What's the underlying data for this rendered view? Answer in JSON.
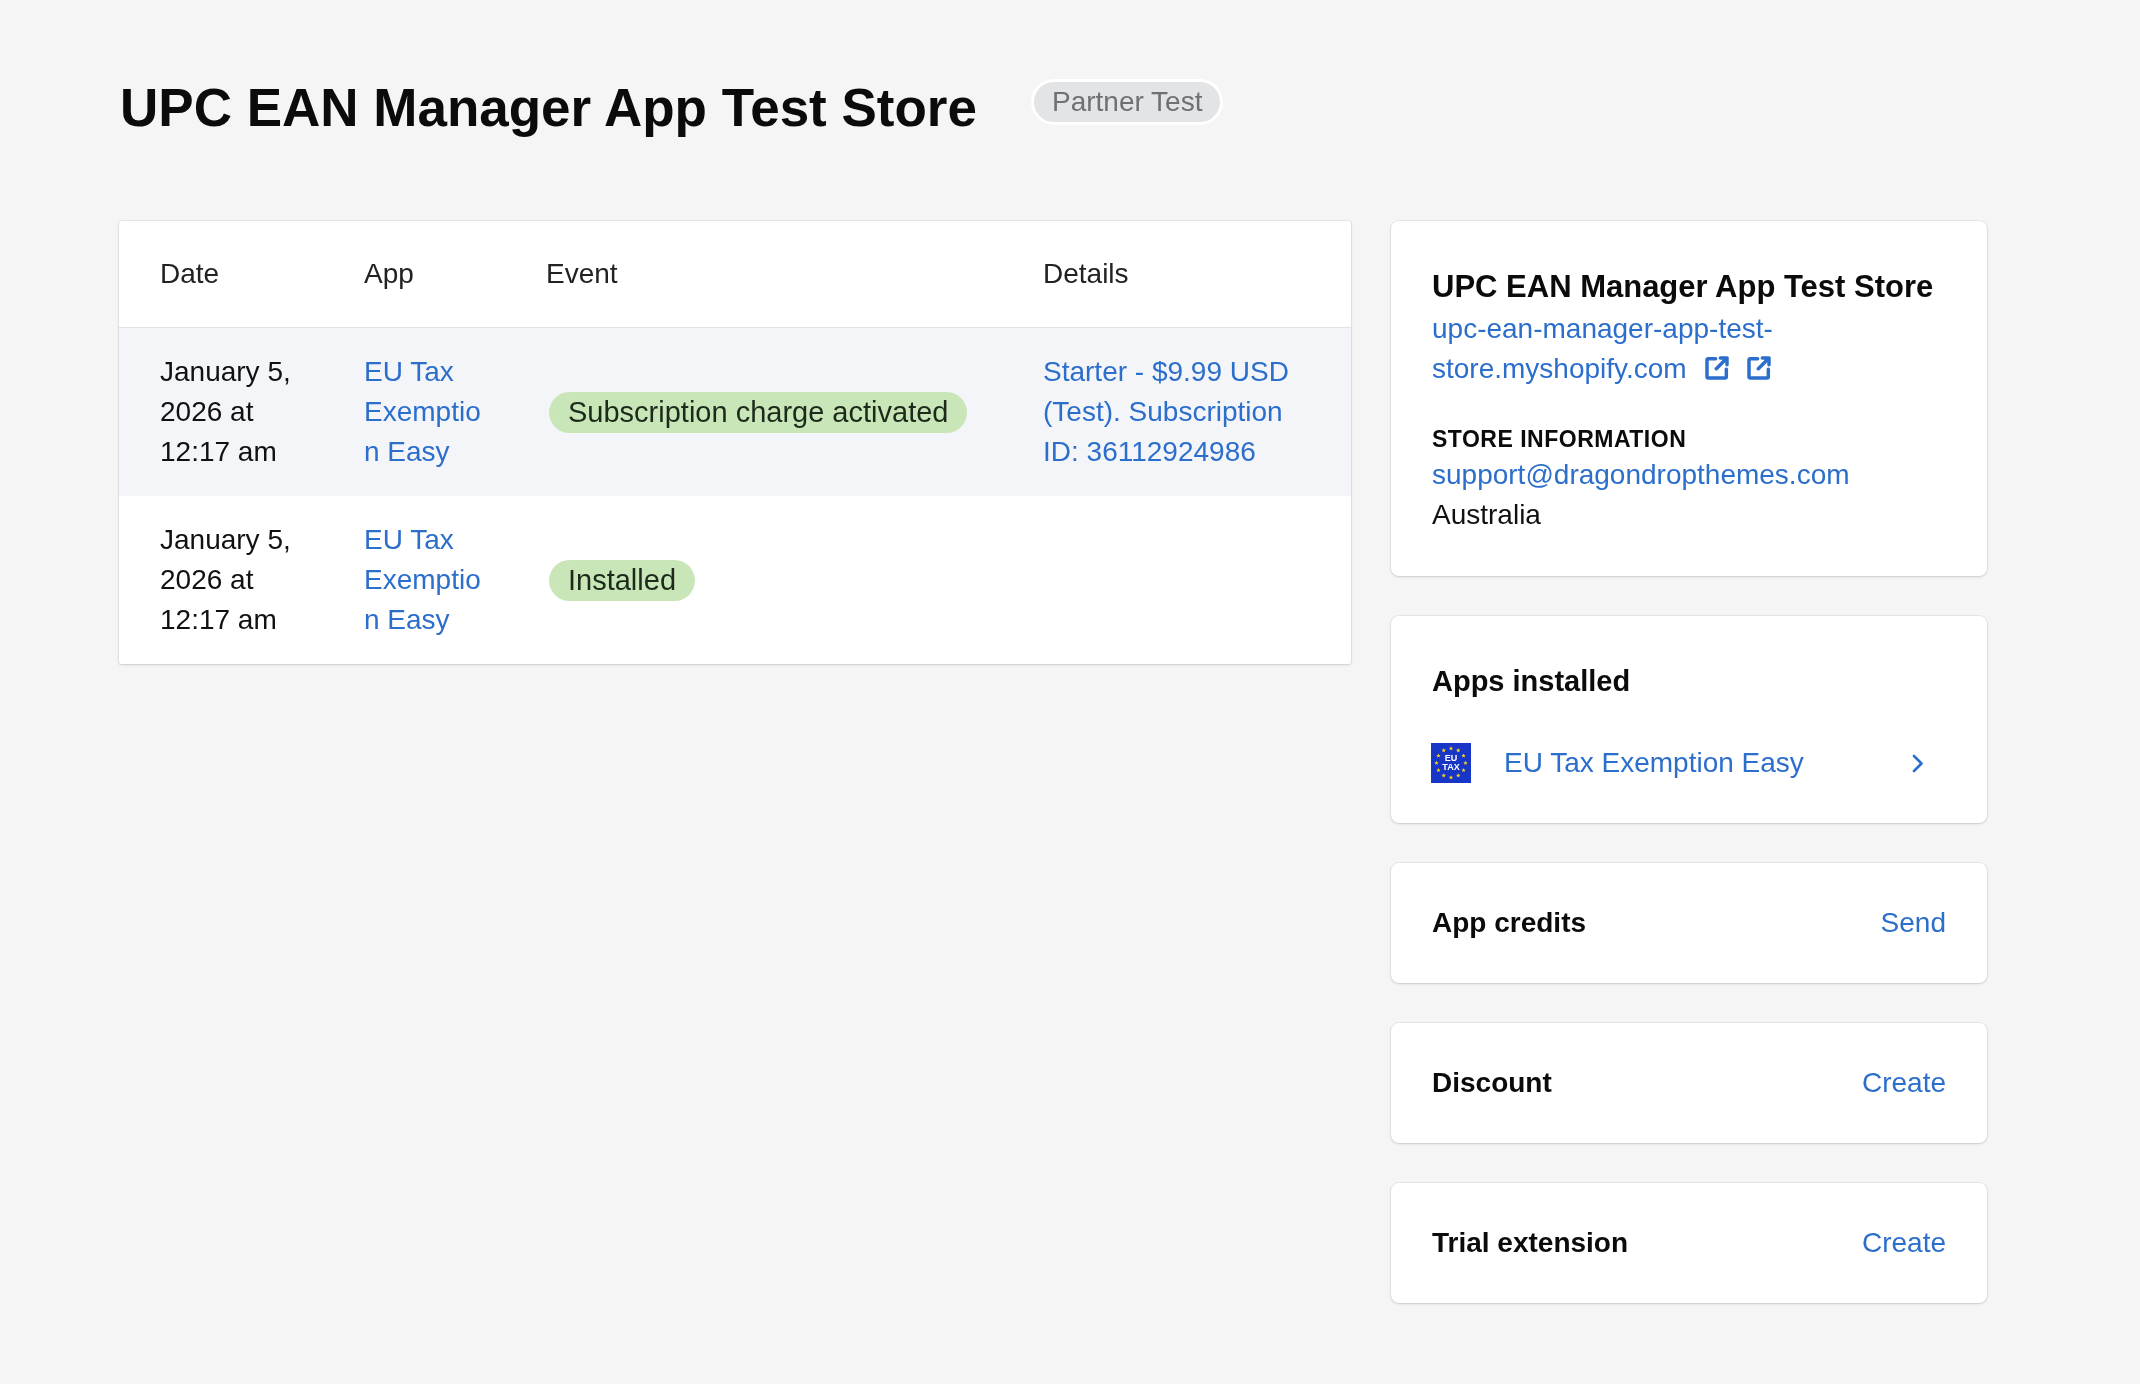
{
  "header": {
    "title": "UPC EAN Manager App Test Store",
    "badge": "Partner Test"
  },
  "table": {
    "columns": [
      "Date",
      "App",
      "Event",
      "Details"
    ],
    "rows": [
      {
        "date": "January 5, 2026 at 12:17 am",
        "app": "EU Tax Exemption Easy",
        "event": "Subscription charge activated",
        "details": "Starter - $9.99 USD (Test). Subscription ID: 36112924986",
        "highlighted": true
      },
      {
        "date": "January 5, 2026 at 12:17 am",
        "app": "EU Tax Exemption Easy",
        "event": "Installed",
        "highlighted": false
      }
    ]
  },
  "store_card": {
    "title": "UPC EAN Manager App Test Store",
    "url": "upc-ean-manager-app-test-store.myshopify.com",
    "section_label": "STORE INFORMATION",
    "email": "support@dragondropthemes.com",
    "country": "Australia"
  },
  "apps_installed": {
    "title": "Apps installed",
    "apps": [
      {
        "name": "EU Tax Exemption Easy",
        "logo_text": "EU TAX"
      }
    ]
  },
  "action_cards": [
    {
      "title": "App credits",
      "action": "Send"
    },
    {
      "title": "Discount",
      "action": "Create"
    },
    {
      "title": "Trial extension",
      "action": "Create"
    }
  ]
}
